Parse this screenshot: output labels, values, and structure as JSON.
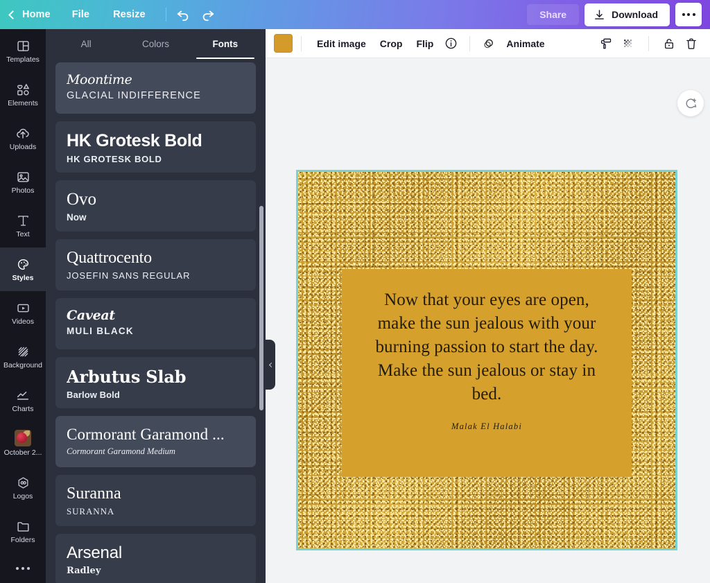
{
  "header": {
    "back_label": "Home",
    "menu": [
      "File",
      "Resize"
    ],
    "undo_icon": "undo-icon",
    "redo_icon": "redo-icon",
    "share_label": "Share",
    "download_label": "Download",
    "more_label": "more-options",
    "gradient_from": "#3ec7c0",
    "gradient_to": "#7d46e0"
  },
  "rail": {
    "items": [
      {
        "label": "Templates",
        "icon": "templates-icon",
        "active": false
      },
      {
        "label": "Elements",
        "icon": "elements-icon",
        "active": false
      },
      {
        "label": "Uploads",
        "icon": "uploads-icon",
        "active": false
      },
      {
        "label": "Photos",
        "icon": "photos-icon",
        "active": false
      },
      {
        "label": "Text",
        "icon": "text-icon",
        "active": false
      },
      {
        "label": "Styles",
        "icon": "styles-icon",
        "active": true
      },
      {
        "label": "Videos",
        "icon": "videos-icon",
        "active": false
      },
      {
        "label": "Background",
        "icon": "background-icon",
        "active": false
      },
      {
        "label": "Charts",
        "icon": "charts-icon",
        "active": false
      },
      {
        "label": "October 2...",
        "icon": "folder-thumbnail-icon",
        "active": false
      },
      {
        "label": "Logos",
        "icon": "logos-icon",
        "active": false
      },
      {
        "label": "Folders",
        "icon": "folders-icon",
        "active": false
      }
    ]
  },
  "panel": {
    "tabs": [
      {
        "label": "All",
        "active": false
      },
      {
        "label": "Colors",
        "active": false
      },
      {
        "label": "Fonts",
        "active": true
      }
    ],
    "font_cards": [
      {
        "title": "Moontime",
        "sub": "GLACIAL INDIFFERENCE",
        "highlighted": true
      },
      {
        "title": "HK Grotesk Bold",
        "sub": "HK GROTESK BOLD",
        "highlighted": false
      },
      {
        "title": "Ovo",
        "sub": "Now",
        "highlighted": false
      },
      {
        "title": "Quattrocento",
        "sub": "JOSEFIN SANS REGULAR",
        "highlighted": false
      },
      {
        "title": "Caveat",
        "sub": "MULI BLACK",
        "highlighted": false
      },
      {
        "title": "Arbutus Slab",
        "sub": "Barlow Bold",
        "highlighted": false
      },
      {
        "title": "Cormorant Garamond ...",
        "sub": "Cormorant Garamond Medium",
        "highlighted": true
      },
      {
        "title": "Suranna",
        "sub": "SURANNA",
        "highlighted": false
      },
      {
        "title": "Arsenal",
        "sub": "Radley",
        "highlighted": false
      }
    ]
  },
  "toolbar": {
    "swatch_color": "#d49b2a",
    "edit_image_label": "Edit image",
    "crop_label": "Crop",
    "flip_label": "Flip",
    "info_label": "info",
    "animate_label": "Animate",
    "copy_style_label": "copy-style",
    "transparency_label": "transparency",
    "lock_label": "lock",
    "delete_label": "delete"
  },
  "canvas": {
    "artboard_background": "#c79b2c",
    "selection_color": "#79d4cf",
    "quote_box_color": "#d6a02c",
    "quote_lines": [
      "Now that your eyes are open,",
      "make the sun jealous with your",
      "burning passion to start the day.",
      "Make the sun jealous or stay in",
      "bed."
    ],
    "quote_text": "Now that your eyes are open, make the sun jealous with your burning passion to start the day. Make the sun jealous or stay in bed.",
    "author": "Malak El Halabi",
    "comment_button_label": "add-comment"
  }
}
